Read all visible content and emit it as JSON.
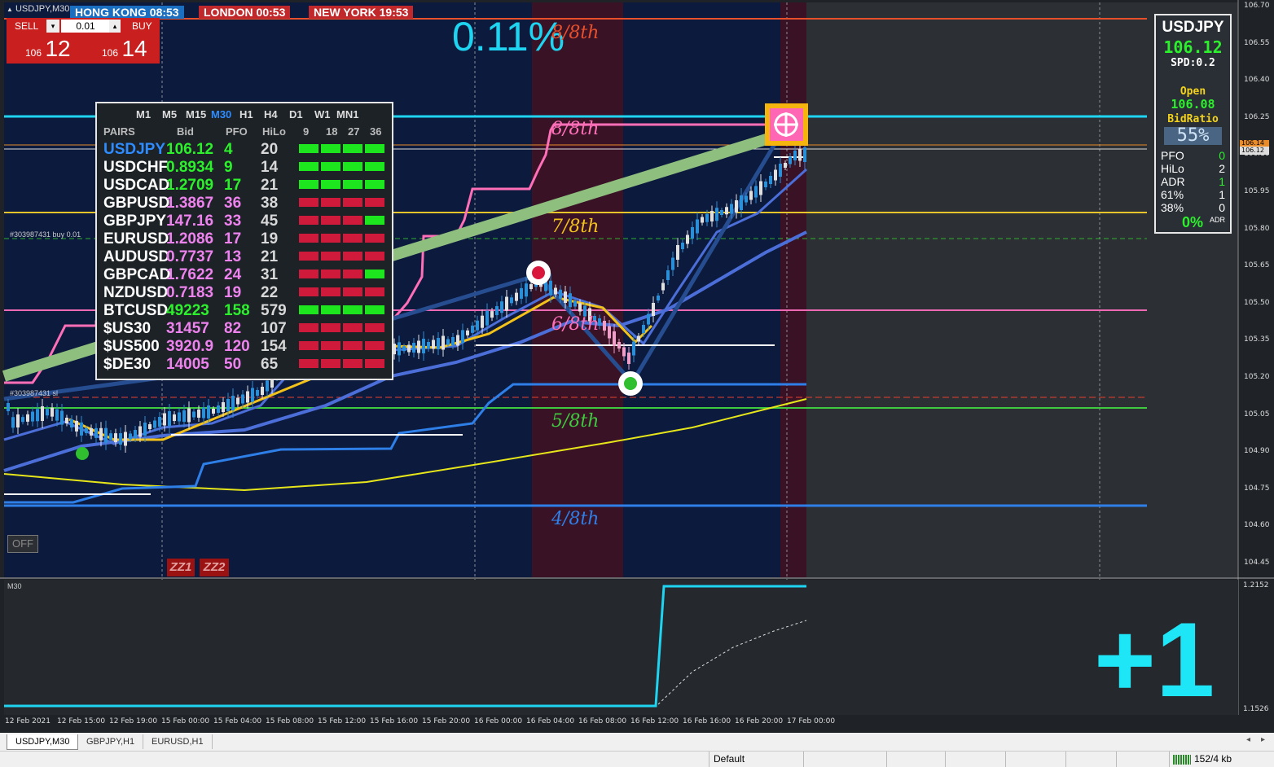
{
  "window": {
    "symbol_title": "USDJPY,M30"
  },
  "sessions": [
    {
      "label": "HONG KONG 08:53",
      "color": "#1a6fc0"
    },
    {
      "label": "LONDON  00:53",
      "color": "#c0282b"
    },
    {
      "label": "NEW YORK 19:53",
      "color": "#c0282b"
    }
  ],
  "trade_panel": {
    "sell_label": "SELL",
    "buy_label": "BUY",
    "lot_value": "0.01",
    "sell_price_small": "106",
    "sell_price_big": "12",
    "buy_price_small": "106",
    "buy_price_big": "14"
  },
  "percent_change": "0.11%",
  "octave_labels": {
    "l8": "8/8th",
    "l7": "7/8th",
    "l6": "6/8th",
    "l5": "5/8th",
    "l4": "4/8th"
  },
  "order_labels": {
    "buy": "#303987431 buy 0.01",
    "sl": "#303987431 sl"
  },
  "dashboard": {
    "timeframes": [
      "M1",
      "M5",
      "M15",
      "M30",
      "H1",
      "H4",
      "D1",
      "W1",
      "MN1"
    ],
    "active_tf": "M30",
    "headers": {
      "pairs": "PAIRS",
      "bid": "Bid",
      "pfo": "PFO",
      "hilo": "HiLo",
      "c9": "9",
      "c18": "18",
      "c27": "27",
      "c36": "36"
    },
    "rows": [
      {
        "pair": "USDJPY",
        "bid": "106.12",
        "pfo": "4",
        "hilo": "20",
        "cells": [
          "g",
          "g",
          "g",
          "g"
        ],
        "pair_color": "#2e8cff",
        "value_color": "#2df02d"
      },
      {
        "pair": "USDCHF",
        "bid": "0.8934",
        "pfo": "9",
        "hilo": "14",
        "cells": [
          "g",
          "g",
          "g",
          "g"
        ],
        "pair_color": "#ffffff",
        "value_color": "#2df02d"
      },
      {
        "pair": "USDCAD",
        "bid": "1.2709",
        "pfo": "17",
        "hilo": "21",
        "cells": [
          "g",
          "g",
          "g",
          "g"
        ],
        "pair_color": "#ffffff",
        "value_color": "#2df02d"
      },
      {
        "pair": "GBPUSD",
        "bid": "1.3867",
        "pfo": "36",
        "hilo": "38",
        "cells": [
          "r",
          "r",
          "r",
          "r"
        ],
        "pair_color": "#ffffff",
        "value_color": "#ee82ee"
      },
      {
        "pair": "GBPJPY",
        "bid": "147.16",
        "pfo": "33",
        "hilo": "45",
        "cells": [
          "r",
          "r",
          "r",
          "g"
        ],
        "pair_color": "#ffffff",
        "value_color": "#ee82ee"
      },
      {
        "pair": "EURUSD",
        "bid": "1.2086",
        "pfo": "17",
        "hilo": "19",
        "cells": [
          "r",
          "r",
          "r",
          "r"
        ],
        "pair_color": "#ffffff",
        "value_color": "#ee82ee"
      },
      {
        "pair": "AUDUSD",
        "bid": "0.7737",
        "pfo": "13",
        "hilo": "21",
        "cells": [
          "r",
          "r",
          "r",
          "r"
        ],
        "pair_color": "#ffffff",
        "value_color": "#ee82ee"
      },
      {
        "pair": "GBPCAD",
        "bid": "1.7622",
        "pfo": "24",
        "hilo": "31",
        "cells": [
          "r",
          "r",
          "r",
          "g"
        ],
        "pair_color": "#ffffff",
        "value_color": "#ee82ee"
      },
      {
        "pair": "NZDUSD",
        "bid": "0.7183",
        "pfo": "19",
        "hilo": "22",
        "cells": [
          "r",
          "r",
          "r",
          "r"
        ],
        "pair_color": "#ffffff",
        "value_color": "#ee82ee"
      },
      {
        "pair": "BTCUSD",
        "bid": "49223",
        "pfo": "158",
        "hilo": "579",
        "cells": [
          "g",
          "g",
          "g",
          "g"
        ],
        "pair_color": "#ffffff",
        "value_color": "#2df02d"
      },
      {
        "pair": "$US30",
        "bid": "31457",
        "pfo": "82",
        "hilo": "107",
        "cells": [
          "r",
          "r",
          "r",
          "r"
        ],
        "pair_color": "#ffffff",
        "value_color": "#ee82ee"
      },
      {
        "pair": "$US500",
        "bid": "3920.9",
        "pfo": "120",
        "hilo": "154",
        "cells": [
          "r",
          "r",
          "r",
          "r"
        ],
        "pair_color": "#ffffff",
        "value_color": "#ee82ee"
      },
      {
        "pair": "$DE30",
        "bid": "14005",
        "pfo": "50",
        "hilo": "65",
        "cells": [
          "r",
          "r",
          "r",
          "r"
        ],
        "pair_color": "#ffffff",
        "value_color": "#ee82ee"
      }
    ]
  },
  "info_panel": {
    "symbol": "USDJPY",
    "price": "106.12",
    "spread": "SPD:0.2",
    "open_label": "Open",
    "open_value": "106.08",
    "bidratio_label": "BidRatio",
    "bidratio_value": "55%",
    "stats": [
      {
        "k": "PFO",
        "v": "0",
        "vcolor": "#2df02d"
      },
      {
        "k": "HiLo",
        "v": "2",
        "vcolor": "#ffffff"
      },
      {
        "k": "ADR",
        "v": "1",
        "vcolor": "#2df02d"
      },
      {
        "k": "61%",
        "v": "1",
        "vcolor": "#ffffff"
      },
      {
        "k": "38%",
        "v": "0",
        "vcolor": "#ffffff"
      }
    ],
    "adr_pct": "0%",
    "adr_tag": "ADR"
  },
  "price_axis": [
    "106.70",
    "106.55",
    "106.40",
    "106.25",
    "106.10",
    "105.95",
    "105.80",
    "105.65",
    "105.50",
    "105.35",
    "105.20",
    "105.05",
    "104.90",
    "104.75",
    "104.60",
    "104.45"
  ],
  "price_axis_tags": {
    "ask": "106.14",
    "bid": "106.12"
  },
  "sub_axis": {
    "top": "1.2152",
    "bottom": "1.1526"
  },
  "time_axis": [
    "12 Feb 2021",
    "12 Feb 15:00",
    "12 Feb 19:00",
    "15 Feb 00:00",
    "15 Feb 04:00",
    "15 Feb 08:00",
    "15 Feb 12:00",
    "15 Feb 16:00",
    "15 Feb 20:00",
    "16 Feb 00:00",
    "16 Feb 04:00",
    "16 Feb 08:00",
    "16 Feb 12:00",
    "16 Feb 16:00",
    "16 Feb 20:00",
    "17 Feb 00:00"
  ],
  "buttons": {
    "off": "OFF",
    "zz1": "ZZ1",
    "zz2": "ZZ2"
  },
  "subwindow": {
    "label": "M30",
    "big_signal": "+1"
  },
  "tabs": [
    "USDJPY,M30",
    "GBPJPY,H1",
    "EURUSD,H1"
  ],
  "status": {
    "profile": "Default",
    "traffic": "152/4 kb"
  }
}
